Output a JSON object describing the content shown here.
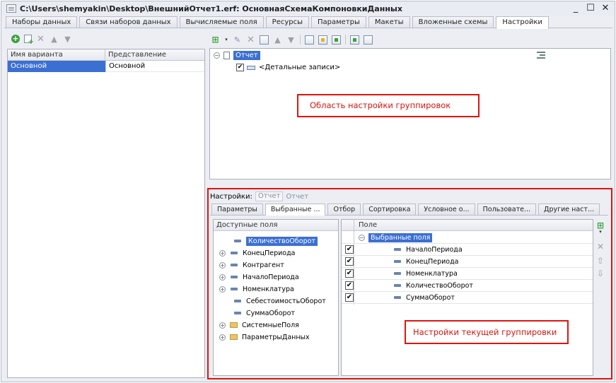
{
  "window": {
    "title": "C:\\Users\\shemyakin\\Desktop\\ВнешнийОтчет1.erf: ОсновнаяСхемаКомпоновкиДанных",
    "controls": [
      "_",
      "☐",
      "✕"
    ]
  },
  "main_tabs": [
    {
      "label": "Наборы данных",
      "active": false
    },
    {
      "label": "Связи наборов данных",
      "active": false
    },
    {
      "label": "Вычисляемые поля",
      "active": false
    },
    {
      "label": "Ресурсы",
      "active": false
    },
    {
      "label": "Параметры",
      "active": false
    },
    {
      "label": "Макеты",
      "active": false
    },
    {
      "label": "Вложенные схемы",
      "active": false
    },
    {
      "label": "Настройки",
      "active": true
    }
  ],
  "variants": {
    "columns": [
      "Имя варианта",
      "Представление"
    ],
    "rows": [
      {
        "name": "Основной",
        "presentation": "Основной"
      }
    ]
  },
  "structure_tree": {
    "root": "Отчет",
    "child": "<Детальные записи>",
    "child_checked": true
  },
  "annotations": {
    "grouping_area": "Область настройки группировок",
    "current_grouping": "Настройки текущей группировки"
  },
  "lower_settings": {
    "label": "Настройки:",
    "crumb_1": "Отчет",
    "crumb_2": "Отчет",
    "tabs": [
      {
        "label": "Параметры",
        "active": false
      },
      {
        "label": "Выбранные ...",
        "active": true
      },
      {
        "label": "Отбор",
        "active": false
      },
      {
        "label": "Сортировка",
        "active": false
      },
      {
        "label": "Условное о...",
        "active": false
      },
      {
        "label": "Пользовате...",
        "active": false
      },
      {
        "label": "Другие наст...",
        "active": false
      }
    ]
  },
  "available_fields": {
    "header": "Доступные поля",
    "items": [
      {
        "label": "КоличествоОборот",
        "expandable": false,
        "type": "field",
        "selected": true
      },
      {
        "label": "КонецПериода",
        "expandable": true,
        "type": "field",
        "selected": false
      },
      {
        "label": "Контрагент",
        "expandable": true,
        "type": "field",
        "selected": false
      },
      {
        "label": "НачалоПериода",
        "expandable": true,
        "type": "field",
        "selected": false
      },
      {
        "label": "Номенклатура",
        "expandable": true,
        "type": "field",
        "selected": false
      },
      {
        "label": "СебестоимостьОборот",
        "expandable": false,
        "type": "field",
        "selected": false
      },
      {
        "label": "СуммаОборот",
        "expandable": false,
        "type": "field",
        "selected": false
      },
      {
        "label": "СистемныеПоля",
        "expandable": true,
        "type": "folder",
        "selected": false
      },
      {
        "label": "ПараметрыДанных",
        "expandable": true,
        "type": "folder",
        "selected": false
      }
    ]
  },
  "selected_fields": {
    "header": "Поле",
    "group": "Выбранные поля",
    "items": [
      {
        "label": "НачалоПериода",
        "checked": true
      },
      {
        "label": "КонецПериода",
        "checked": true
      },
      {
        "label": "Номенклатура",
        "checked": true
      },
      {
        "label": "КоличествоОборот",
        "checked": true
      },
      {
        "label": "СуммаОборот",
        "checked": true
      }
    ]
  },
  "colors": {
    "selection": "#3b6fd2",
    "annotation_red": "#e0140f",
    "add_green": "#3aa03a"
  }
}
